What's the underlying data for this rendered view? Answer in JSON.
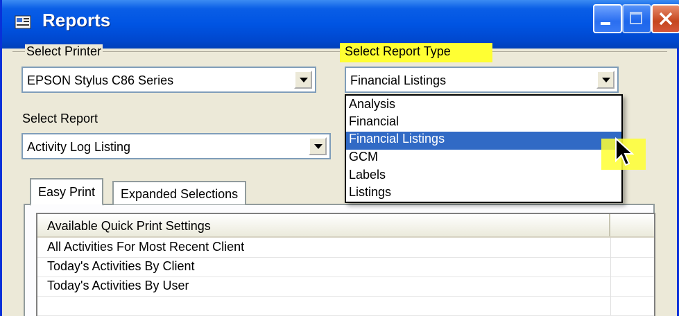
{
  "window": {
    "title": "Reports"
  },
  "printer": {
    "label": "Select Printer",
    "value": "EPSON Stylus C86 Series"
  },
  "report_type": {
    "label": "Select Report Type",
    "value": "Financial Listings",
    "options": [
      "Analysis",
      "Financial",
      "Financial Listings",
      "GCM",
      "Labels",
      "Listings"
    ],
    "selected_index": 2
  },
  "report": {
    "label": "Select Report",
    "value": "Activity Log Listing"
  },
  "tabs": [
    "Easy Print",
    "Expanded Selections"
  ],
  "grid": {
    "header": "Available Quick Print Settings",
    "rows": [
      "All Activities For Most Recent Client",
      "Today's Activities By Client",
      "Today's Activities By User"
    ]
  },
  "colors": {
    "titlebar": "#0054e3",
    "highlight": "#ffff33",
    "selection": "#316ac5"
  },
  "icons": [
    "app-icon",
    "minimize-icon",
    "maximize-icon",
    "close-icon",
    "chevron-down-icon",
    "mouse-cursor-icon"
  ]
}
